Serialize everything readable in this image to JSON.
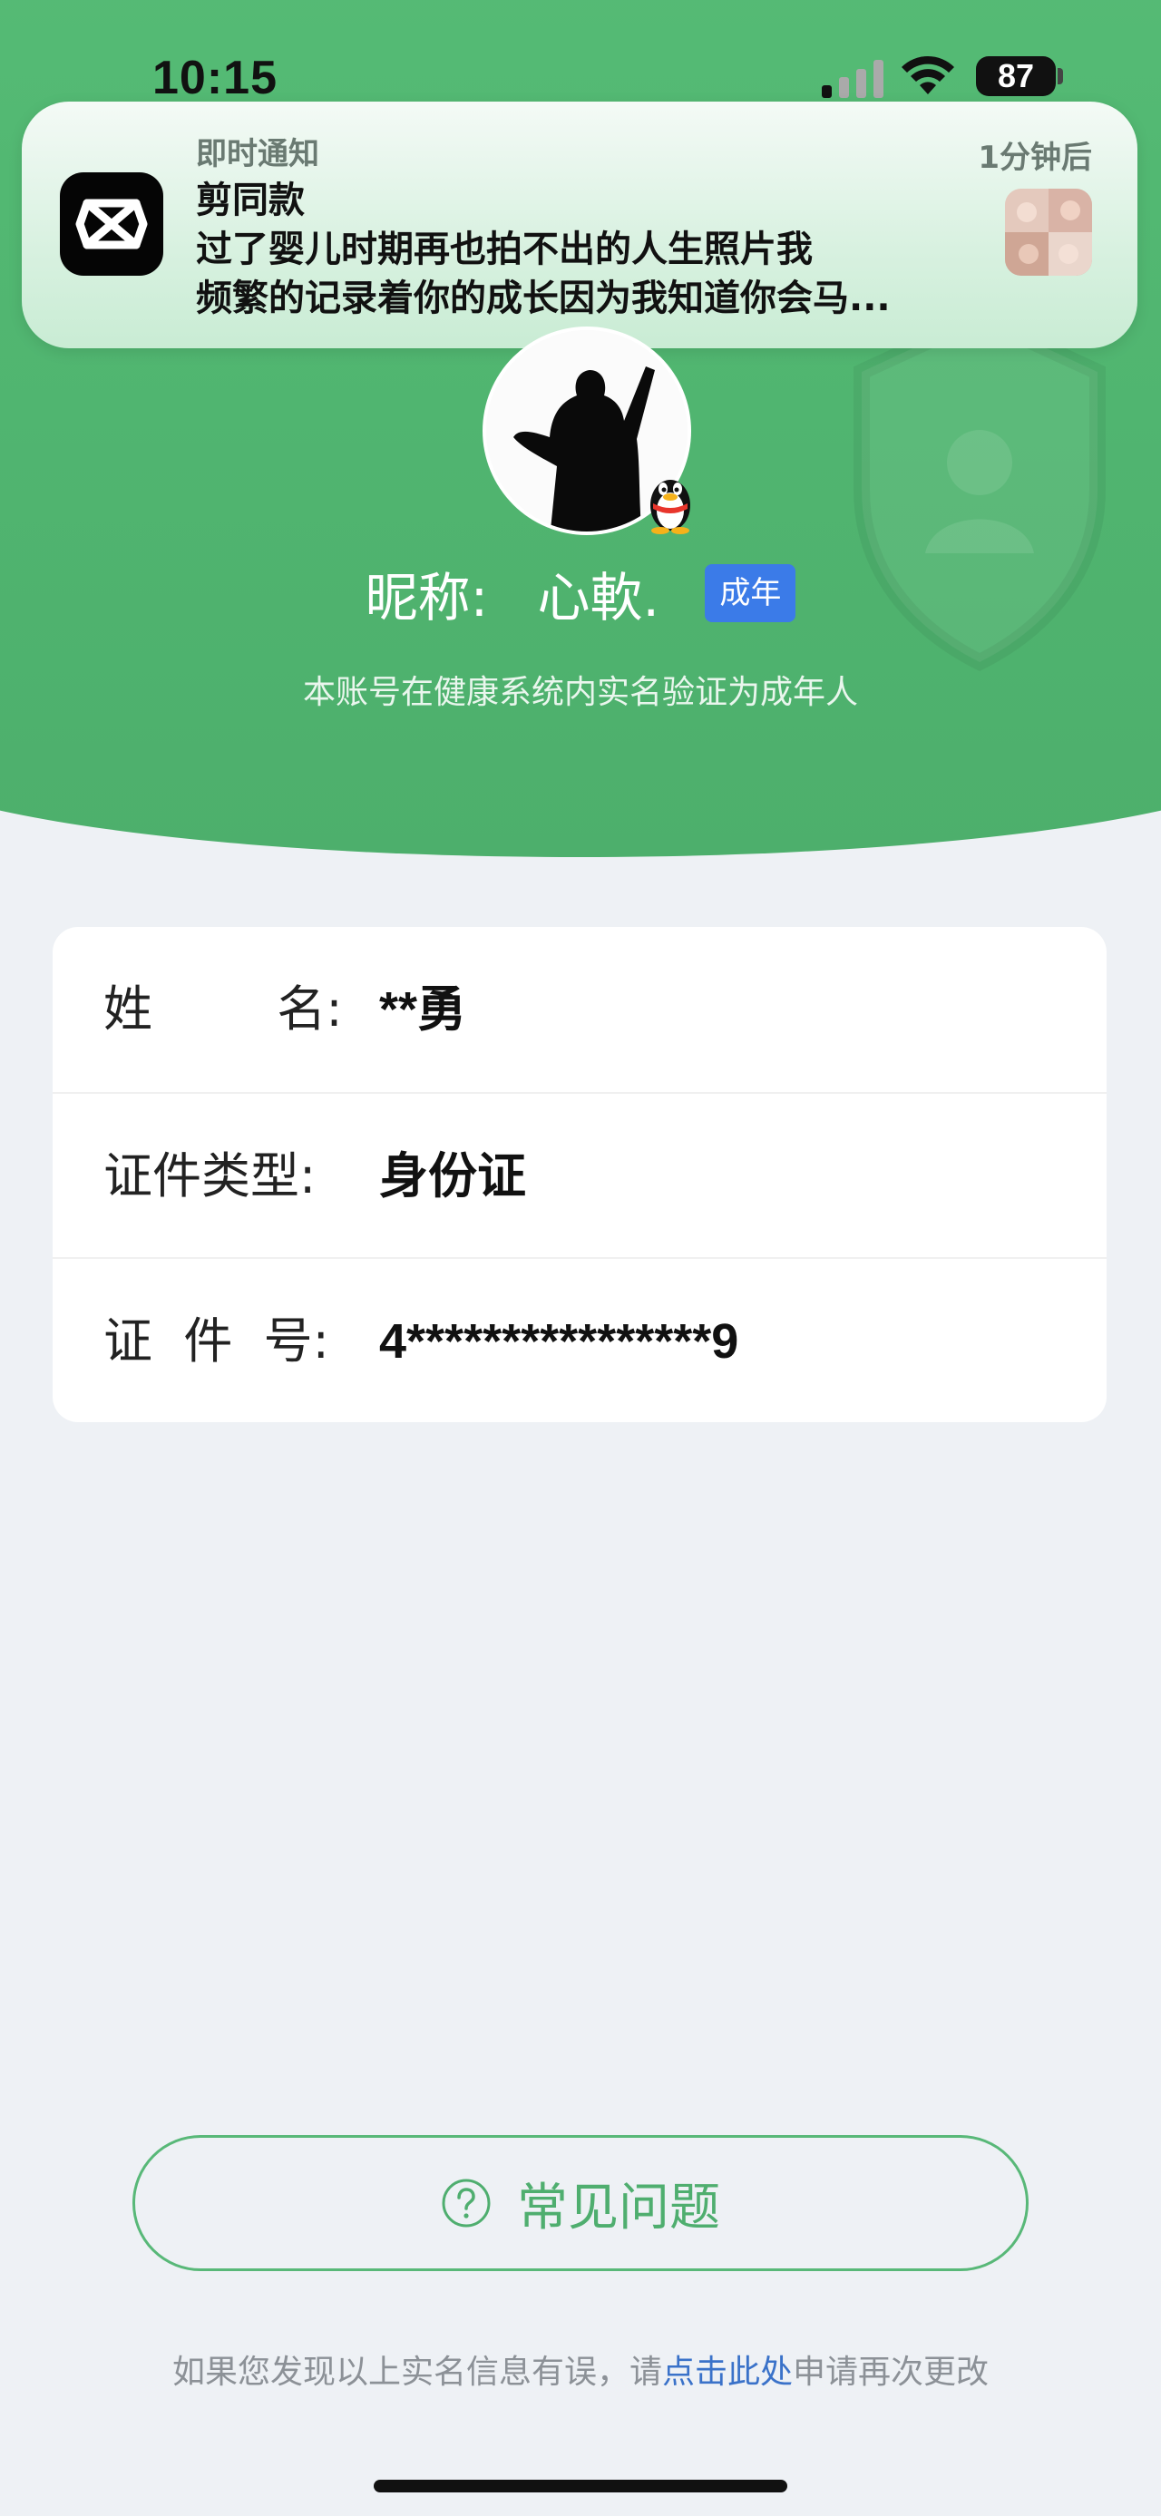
{
  "status_bar": {
    "time": "10:15",
    "battery": "87",
    "signal_icon": "cellular-signal-icon",
    "wifi_icon": "wifi-icon"
  },
  "notification": {
    "category": "即时通知",
    "time": "1分钟后",
    "app_name": "剪同款",
    "line1": "过了婴儿时期再也拍不出的人生照片我",
    "line2": "频繁的记录着你的成长因为我知道你会马...",
    "app_icon": "capcut-icon"
  },
  "profile": {
    "nickname_label": "昵称:",
    "nickname": "心軟.",
    "adult_badge": "成年",
    "verify_text": "本账号在健康系统内实名验证为成年人",
    "badge_icon": "qq-penguin-icon"
  },
  "info": {
    "rows": [
      {
        "label": "姓        名:",
        "value": "**勇"
      },
      {
        "label": "证件类型:",
        "value": "身份证"
      },
      {
        "label": "证  件  号:",
        "value": "4****************9"
      }
    ]
  },
  "faq": {
    "label": "常见问题",
    "icon": "question-circle-icon"
  },
  "footer": {
    "prefix": "如果您发现以上实名信息有误，请",
    "link": "点击此处",
    "suffix": "申请再次更改"
  },
  "colors": {
    "brand_green": "#52b872",
    "badge_blue": "#3b7be8",
    "link_blue": "#3a72c9"
  }
}
